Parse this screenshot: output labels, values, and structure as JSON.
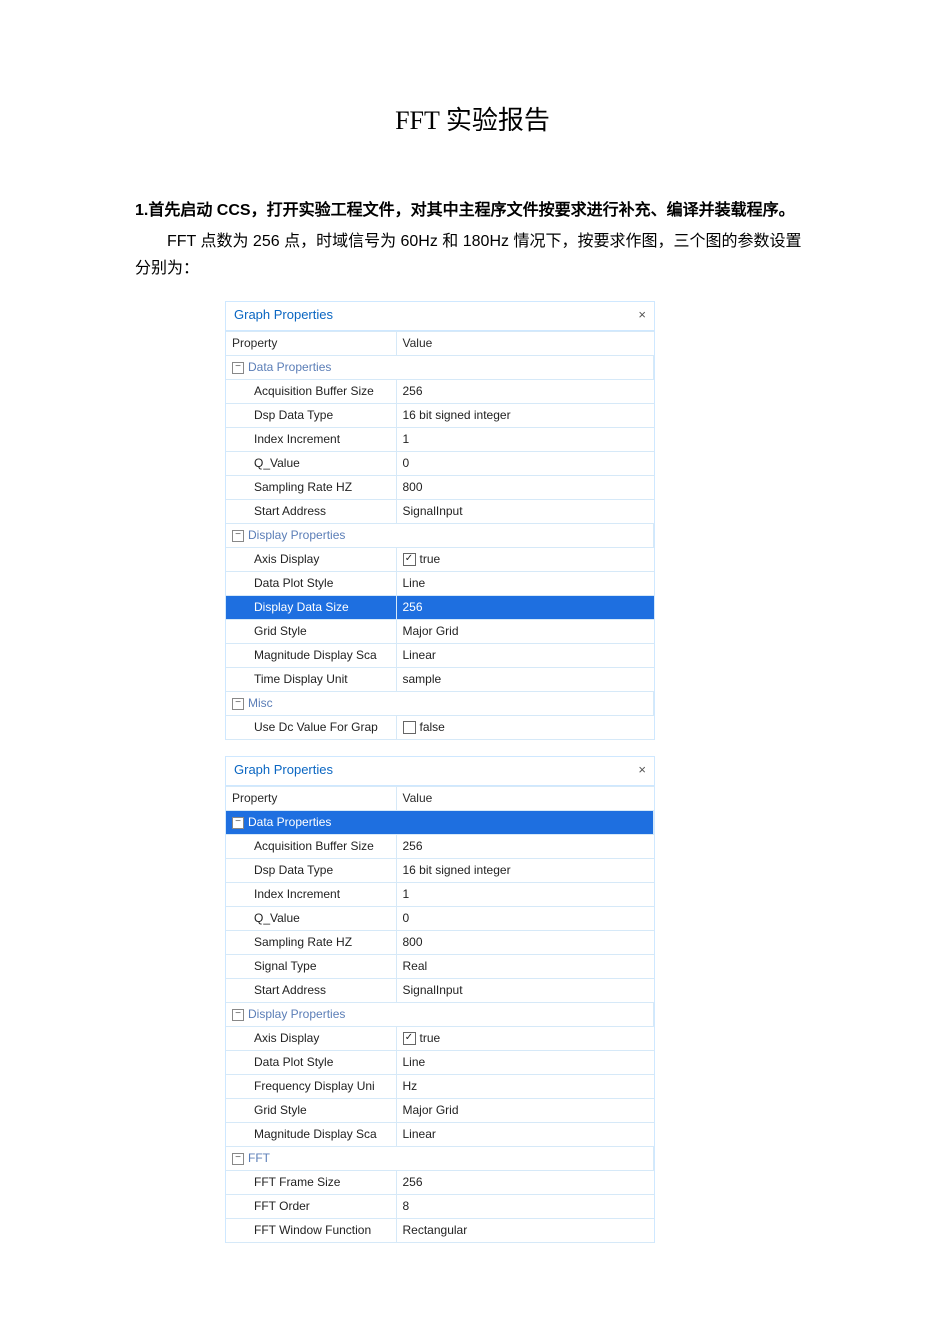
{
  "title": "FFT 实验报告",
  "heading1": "1.首先启动 CCS，打开实验工程文件，对其中主程序文件按要求进行补充、编译并装载程序。",
  "para1": "FFT 点数为 256 点，时域信号为 60Hz 和 180Hz 情况下，按要求作图，三个图的参数设置分别为：",
  "headers": {
    "prop": "Property",
    "val": "Value"
  },
  "panel1": {
    "title": "Graph Properties",
    "groups": {
      "g1": "Data Properties",
      "g2": "Display Properties",
      "g3": "Misc"
    },
    "rows": {
      "r1k": "Acquisition Buffer Size",
      "r1v": "256",
      "r2k": "Dsp Data Type",
      "r2v": "16 bit signed integer",
      "r3k": "Index Increment",
      "r3v": "1",
      "r4k": "Q_Value",
      "r4v": "0",
      "r5k": "Sampling Rate HZ",
      "r5v": "800",
      "r6k": "Start Address",
      "r6v": "SignalInput",
      "r7k": "Axis Display",
      "r7v": "true",
      "r8k": "Data Plot Style",
      "r8v": "Line",
      "r9k": "Display Data Size",
      "r9v": "256",
      "r10k": "Grid Style",
      "r10v": "Major Grid",
      "r11k": "Magnitude Display Sca",
      "r11v": "Linear",
      "r12k": "Time Display Unit",
      "r12v": "sample",
      "r13k": "Use Dc Value For Grap",
      "r13v": "false"
    }
  },
  "panel2": {
    "title": "Graph Properties",
    "groups": {
      "g1": "Data Properties",
      "g2": "Display Properties",
      "g3": "FFT"
    },
    "rows": {
      "r1k": "Acquisition Buffer Size",
      "r1v": "256",
      "r2k": "Dsp Data Type",
      "r2v": "16 bit signed integer",
      "r3k": "Index Increment",
      "r3v": "1",
      "r4k": "Q_Value",
      "r4v": "0",
      "r5k": "Sampling Rate HZ",
      "r5v": "800",
      "r6k": "Signal Type",
      "r6v": "Real",
      "r7k": "Start Address",
      "r7v": "SignalInput",
      "r8k": "Axis Display",
      "r8v": "true",
      "r9k": "Data Plot Style",
      "r9v": "Line",
      "r10k": "Frequency Display Uni",
      "r10v": "Hz",
      "r11k": "Grid Style",
      "r11v": "Major Grid",
      "r12k": "Magnitude Display Sca",
      "r12v": "Linear",
      "r13k": "FFT Frame Size",
      "r13v": "256",
      "r14k": "FFT Order",
      "r14v": "8",
      "r15k": "FFT Window Function",
      "r15v": "Rectangular"
    }
  }
}
